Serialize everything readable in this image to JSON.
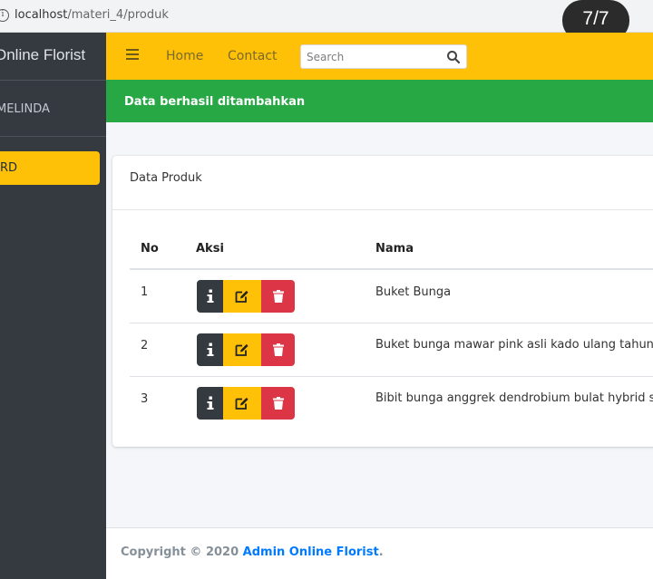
{
  "browser": {
    "url_host": "localhost",
    "url_path": "/materi_4/produk",
    "page_counter": "7/7"
  },
  "sidebar": {
    "brand": "Online Florist",
    "user": "MELINDA",
    "active_item": "RD"
  },
  "navbar": {
    "menu_icon": "hamburger-icon",
    "links": [
      "Home",
      "Contact"
    ],
    "search_placeholder": "Search",
    "search_icon": "search-icon"
  },
  "alert": {
    "message": "Data berhasil ditambahkan",
    "color": "#28a745"
  },
  "card": {
    "title": "Data Produk",
    "columns": [
      "No",
      "Aksi",
      "Nama"
    ],
    "rows": [
      {
        "no": "1",
        "nama": "Buket Bunga"
      },
      {
        "no": "2",
        "nama": "Buket bunga mawar pink asli kado ulang tahun"
      },
      {
        "no": "3",
        "nama": "Bibit bunga anggrek dendrobium bulat hybrid seedling"
      }
    ],
    "action_icons": [
      "info-icon",
      "edit-icon",
      "trash-icon"
    ]
  },
  "footer": {
    "prefix": "Copyright © 2020 ",
    "link_text": "Admin Online Florist",
    "suffix": "."
  },
  "colors": {
    "sidebar_bg": "#343a40",
    "navbar_bg": "#ffc107",
    "danger": "#dc3545",
    "link": "#007bff"
  }
}
